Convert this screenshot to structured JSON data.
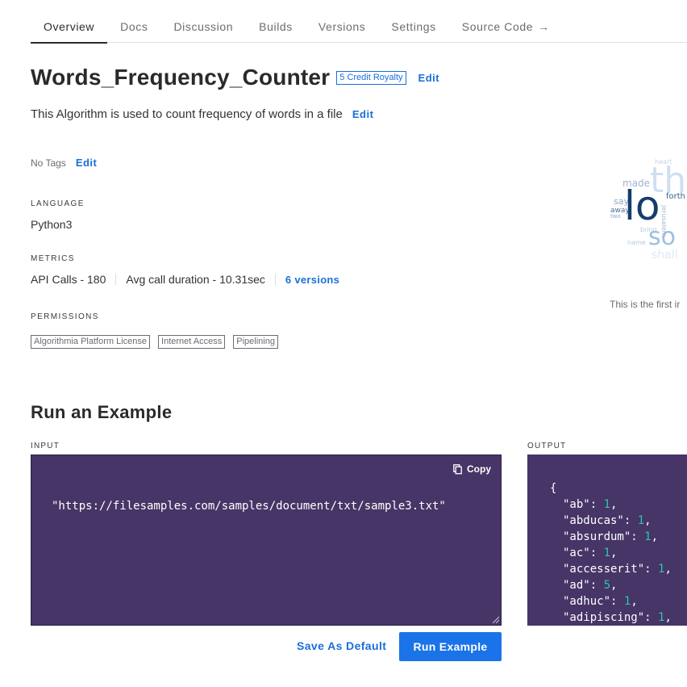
{
  "tabs": [
    {
      "label": "Overview",
      "active": true
    },
    {
      "label": "Docs"
    },
    {
      "label": "Discussion"
    },
    {
      "label": "Builds"
    },
    {
      "label": "Versions"
    },
    {
      "label": "Settings"
    },
    {
      "label": "Source Code"
    }
  ],
  "source_code_icon": "arrow-right-icon",
  "algorithm": {
    "title": "Words_Frequency_Counter",
    "royalty": "5 Credit Royalty",
    "edit_label": "Edit",
    "description": "This Algorithm is used to count frequency of words in a file",
    "no_tags": "No Tags"
  },
  "language": {
    "label": "LANGUAGE",
    "value": "Python3"
  },
  "metrics": {
    "label": "METRICS",
    "api_calls": "API Calls - 180",
    "avg_duration": "Avg call duration - 10.31sec",
    "versions": "6 versions"
  },
  "permissions": {
    "label": "PERMISSIONS",
    "items": [
      "Algorithmia Platform License",
      "Internet Access",
      "Pipelining"
    ]
  },
  "word_cloud": {
    "words": [
      "heart",
      "the",
      "made",
      "forth",
      "say",
      "away",
      "two",
      "lo",
      "bring",
      "name",
      "so",
      "shall",
      "jerusalem"
    ],
    "caption": "This is the first ir"
  },
  "run_example": {
    "title": "Run an Example",
    "input_label": "INPUT",
    "output_label": "OUTPUT",
    "input_value": "\"https://filesamples.com/samples/document/txt/sample3.txt\"",
    "copy_label": "Copy",
    "copy_icon": "copy-icon",
    "output_open": "{",
    "output": [
      {
        "key": "\"ab\"",
        "value": "1"
      },
      {
        "key": "\"abducas\"",
        "value": "1"
      },
      {
        "key": "\"absurdum\"",
        "value": "1"
      },
      {
        "key": "\"ac\"",
        "value": "1"
      },
      {
        "key": "\"accesserit\"",
        "value": "1"
      },
      {
        "key": "\"ad\"",
        "value": "5"
      },
      {
        "key": "\"adhuc\"",
        "value": "1"
      },
      {
        "key": "\"adipiscing\"",
        "value": "1"
      }
    ],
    "save_default_label": "Save As Default",
    "run_label": "Run Example"
  },
  "colors": {
    "accent": "#1a73e8",
    "code_bg": "#463566",
    "number": "#2ec4b6"
  }
}
